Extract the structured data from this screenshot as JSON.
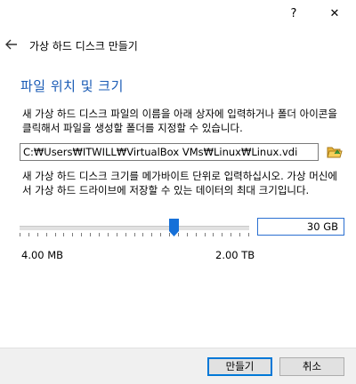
{
  "titlebar": {
    "help_label": "?",
    "close_label": "✕"
  },
  "header": {
    "back_icon": "back-arrow-icon",
    "title": "가상 하드 디스크 만들기"
  },
  "section": {
    "title": "파일 위치 및 크기"
  },
  "location": {
    "description": "새 가상 하드 디스크 파일의 이름을 아래 상자에 입력하거나 폴더 아이콘을 클릭해서 파일을 생성할 폴더를 지정할 수 있습니다.",
    "path_value": "C:₩Users₩ITWILL₩VirtualBox VMs₩Linux₩Linux.vdi",
    "folder_icon": "folder-open-icon"
  },
  "size": {
    "description": "새 가상 하드 디스크 크기를 메가바이트 단위로 입력하십시오. 가상 머신에서 가상 하드 드라이브에 저장할 수 있는 데이터의 최대 크기입니다.",
    "value": "30 GB",
    "slider_fraction": 0.68,
    "min_label": "4.00 MB",
    "max_label": "2.00 TB"
  },
  "footer": {
    "create_label": "만들기",
    "cancel_label": "취소"
  },
  "colors": {
    "accent": "#1a5bb5",
    "focus_border": "#0078d7",
    "slider_thumb": "#1670d8"
  }
}
